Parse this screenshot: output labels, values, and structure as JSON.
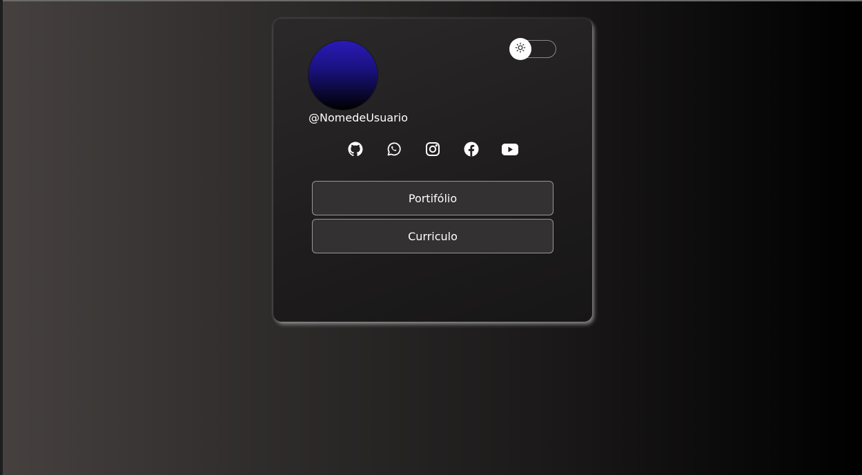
{
  "profile": {
    "username": "@NomedeUsuario",
    "avatar_gradient": [
      "#2a1ab8",
      "#000000"
    ]
  },
  "theme_toggle": {
    "icon": "sun-icon",
    "state": "dark"
  },
  "socials": [
    {
      "name": "github",
      "icon": "github-icon"
    },
    {
      "name": "whatsapp",
      "icon": "whatsapp-icon"
    },
    {
      "name": "instagram",
      "icon": "instagram-icon"
    },
    {
      "name": "facebook",
      "icon": "facebook-icon"
    },
    {
      "name": "youtube",
      "icon": "youtube-icon"
    }
  ],
  "links": [
    {
      "label": "Portifólio"
    },
    {
      "label": "Curriculo"
    }
  ],
  "colors": {
    "card_background": "#201e1e",
    "button_background": "#333131",
    "button_border": "#9a9a9a",
    "text": "#ffffff"
  }
}
